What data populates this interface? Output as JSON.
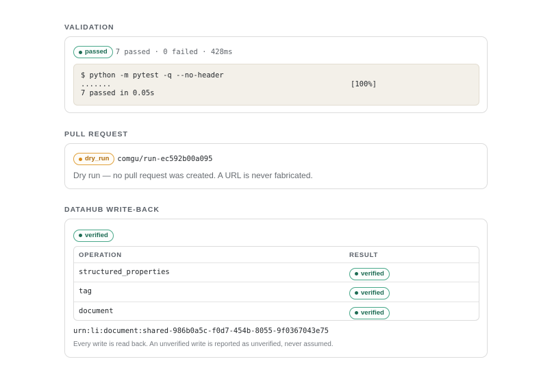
{
  "validation": {
    "title": "VALIDATION",
    "badge": "passed",
    "summary": "7 passed · 0 failed · 428ms",
    "terminal": {
      "command": "$ python -m pytest -q --no-header",
      "progress": ".......",
      "percent": "[100%]",
      "result": "7 passed in 0.05s"
    }
  },
  "pull_request": {
    "title": "PULL REQUEST",
    "badge": "dry_run",
    "branch": "comgu/run-ec592b00a095",
    "message": "Dry run — no pull request was created. A URL is never fabricated."
  },
  "datahub": {
    "title": "DATAHUB WRITE-BACK",
    "badge": "verified",
    "columns": {
      "operation": "OPERATION",
      "result": "RESULT"
    },
    "rows": [
      {
        "operation": "structured_properties",
        "result": "verified"
      },
      {
        "operation": "tag",
        "result": "verified"
      },
      {
        "operation": "document",
        "result": "verified"
      }
    ],
    "urn": "urn:li:document:shared-986b0a5c-f0d7-454b-8055-9f0367043e75",
    "note": "Every write is read back. An unverified write is reported as unverified, never assumed."
  },
  "colors": {
    "verified_green": "#1d6b53",
    "dry_run_amber": "#d98a18",
    "terminal_bg": "#f3f0e9"
  }
}
